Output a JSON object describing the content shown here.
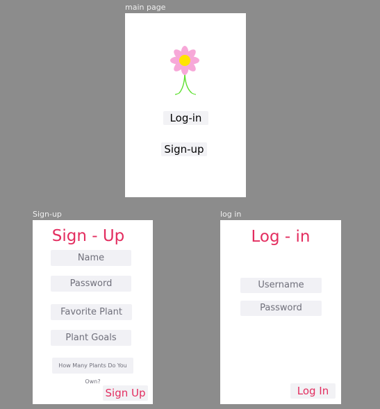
{
  "main_page": {
    "frame_label": "main page",
    "login_button": "Log-in",
    "signup_button": "Sign-up",
    "logo_icon": "flower-icon",
    "colors": {
      "petal": "#f7a8d8",
      "center": "#ffe400",
      "stem": "#5ce02e"
    }
  },
  "signup": {
    "frame_label": "Sign-up",
    "title": "Sign - Up",
    "fields": {
      "name": "Name",
      "password": "Password",
      "favorite_plant": "Favorite Plant",
      "plant_goals": "Plant Goals",
      "plant_count": "How Many Plants Do You Own?"
    },
    "submit": "Sign Up"
  },
  "login": {
    "frame_label": "log in",
    "title": "Log - in",
    "fields": {
      "username": "Username",
      "password": "Password"
    },
    "submit": "Log In"
  },
  "colors": {
    "canvas": "#8c8c8c",
    "accent": "#e32d5f",
    "field_bg": "#f1f1f5"
  }
}
